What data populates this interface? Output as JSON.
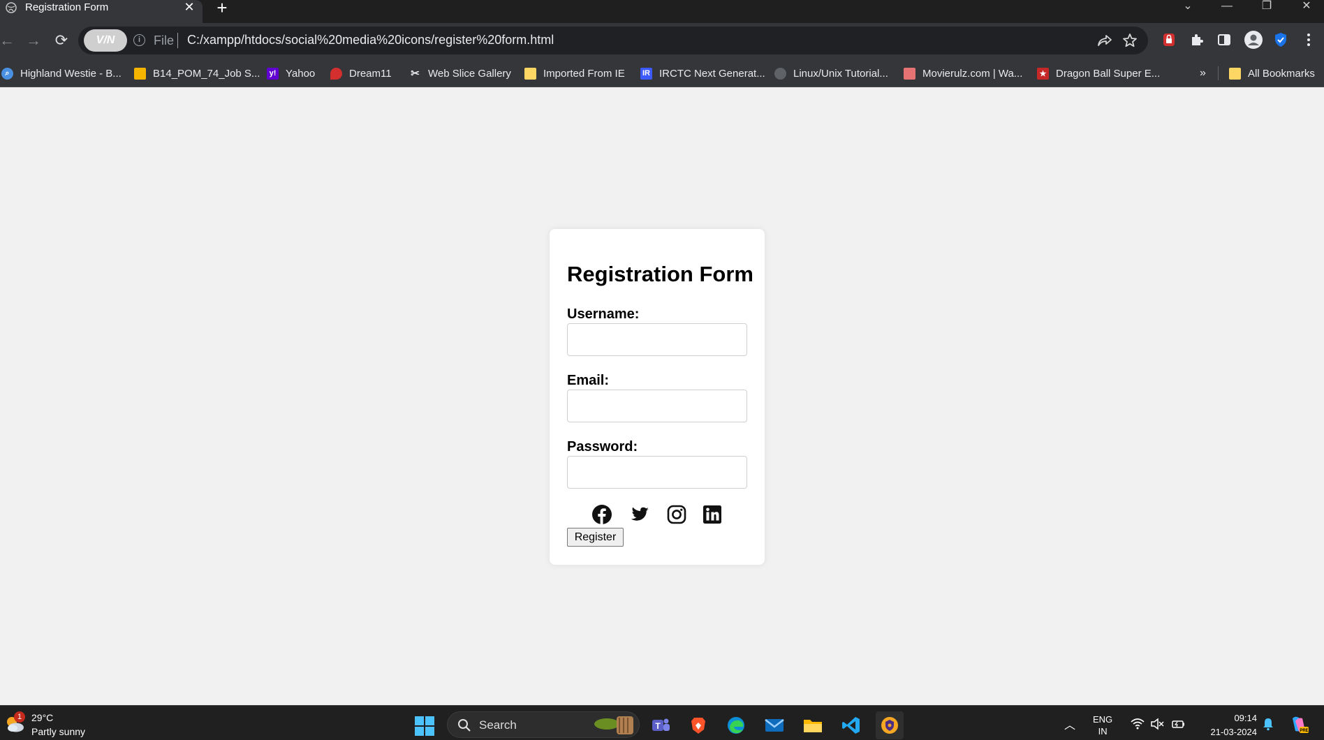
{
  "browser": {
    "tab": {
      "title": "Registration Form",
      "close_glyph": "✕"
    },
    "new_tab_glyph": "+",
    "window_controls": {
      "tab_search": "⌄",
      "minimize": "—",
      "restore": "❐",
      "close": "✕"
    },
    "nav": {
      "back": "←",
      "forward": "→",
      "reload": "⟳"
    },
    "omnibox": {
      "vpn_label": "V/N",
      "info_glyph": "i",
      "scheme_label": "File",
      "url": "C:/xampp/htdocs/social%20media%20icons/register%20form.html"
    },
    "bookmarks": [
      {
        "label": "Highland Westie - B...",
        "icon": "search-icon",
        "color": "#4a90e2"
      },
      {
        "label": "B14_POM_74_Job S...",
        "icon": "slides-icon",
        "color": "#f4b400"
      },
      {
        "label": "Yahoo",
        "icon": "yahoo-icon",
        "color": "#6001d2"
      },
      {
        "label": "Dream11",
        "icon": "dream11-icon",
        "color": "#d32f2f"
      },
      {
        "label": "Web Slice Gallery",
        "icon": "web-slice-icon",
        "color": "#e8eaed"
      },
      {
        "label": "Imported From IE",
        "icon": "folder-icon",
        "color": "#fdd663"
      },
      {
        "label": "IRCTC Next Generat...",
        "icon": "irctc-icon",
        "color": "#3d5afe"
      },
      {
        "label": "Linux/Unix Tutorial...",
        "icon": "linux-icon",
        "color": "#5f6368"
      },
      {
        "label": "Movierulz.com | Wa...",
        "icon": "movie-icon",
        "color": "#e57373"
      },
      {
        "label": "Dragon Ball Super E...",
        "icon": "star-icon",
        "color": "#c62828"
      }
    ],
    "bookmarks_overflow": "»",
    "all_bookmarks": "All Bookmarks"
  },
  "page": {
    "form_title": "Registration Form",
    "fields": {
      "username": {
        "label": "Username:",
        "value": "",
        "placeholder": ""
      },
      "email": {
        "label": "Email:",
        "value": "",
        "placeholder": ""
      },
      "password": {
        "label": "Password:",
        "value": "",
        "placeholder": ""
      }
    },
    "social_icons": [
      "facebook-icon",
      "twitter-icon",
      "instagram-icon",
      "linkedin-icon"
    ],
    "register_button": "Register"
  },
  "taskbar": {
    "weather": {
      "badge": "1",
      "temp": "29°C",
      "desc": "Partly sunny"
    },
    "search_label": "Search",
    "apps": [
      "teams-icon",
      "brave-icon",
      "edge-icon",
      "mail-icon",
      "file-explorer-icon",
      "vscode-icon",
      "vpn-app-icon"
    ],
    "tray": {
      "lang_line1": "ENG",
      "lang_line2": "IN",
      "time": "09:14",
      "date": "21-03-2024"
    }
  },
  "colors": {
    "page_bg": "#f1f1f1",
    "card_bg": "#ffffff",
    "chrome_dark": "#35363a",
    "tab_strip": "#1f1f1f",
    "taskbar": "#202020"
  }
}
